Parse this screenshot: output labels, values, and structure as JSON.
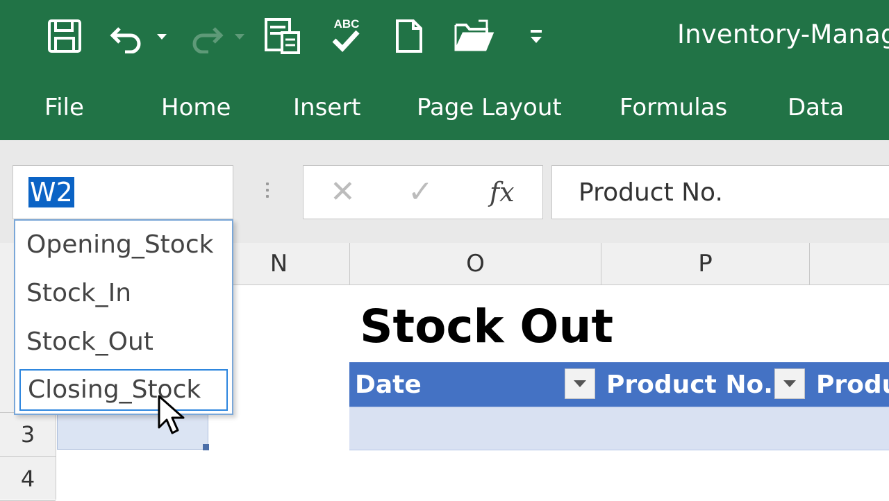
{
  "window": {
    "title": "Inventory-Manage"
  },
  "ribbon": {
    "tabs": [
      "File",
      "Home",
      "Insert",
      "Page Layout",
      "Formulas",
      "Data"
    ]
  },
  "formula_bar": {
    "name_box_value": "W2",
    "formula_value": "Product No.",
    "fx_label": "fx"
  },
  "name_box_dropdown": {
    "items": [
      "Opening_Stock",
      "Stock_In",
      "Stock_Out",
      "Closing_Stock"
    ],
    "hovered": "Closing_Stock"
  },
  "grid": {
    "column_headers": [
      "N",
      "O",
      "P"
    ],
    "row_headers": [
      "3",
      "4"
    ]
  },
  "sheet": {
    "heading": "Stock Out",
    "table_headers": [
      "Date",
      "Product No.",
      "Produ"
    ]
  },
  "colors": {
    "excel_green": "#217346",
    "table_header_blue": "#4472c4",
    "table_row_blue": "#d9e1f2",
    "selection_blue": "#0b63c5"
  },
  "icons": [
    "save-icon",
    "undo-icon",
    "redo-icon",
    "form-icon",
    "spelling-icon",
    "new-file-icon",
    "open-folder-icon",
    "customize-qat-icon",
    "cancel-icon",
    "enter-icon",
    "fx-icon",
    "filter-dropdown-icon",
    "mouse-cursor-icon"
  ]
}
